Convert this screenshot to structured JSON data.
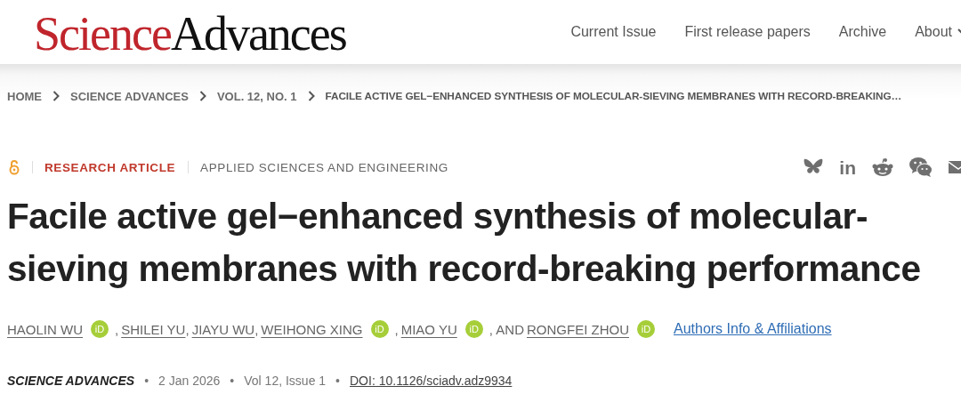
{
  "logo": {
    "first": "Science",
    "second": "Advances"
  },
  "nav": [
    {
      "label": "Current Issue",
      "dropdown": false
    },
    {
      "label": "First release papers",
      "dropdown": false
    },
    {
      "label": "Archive",
      "dropdown": false
    },
    {
      "label": "About",
      "dropdown": true
    }
  ],
  "breadcrumbs": [
    "HOME",
    "SCIENCE ADVANCES",
    "VOL. 12, NO. 1",
    "FACILE ACTIVE GEL−ENHANCED SYNTHESIS OF MOLECULAR-SIEVING MEMBRANES WITH RECORD-BREAKING…"
  ],
  "article": {
    "open_access": true,
    "type": "RESEARCH ARTICLE",
    "subject": "APPLIED SCIENCES AND ENGINEERING",
    "share": [
      {
        "kind": "butterfly"
      },
      {
        "kind": "linkedin",
        "text": "in"
      },
      {
        "kind": "reddit"
      },
      {
        "kind": "wechat"
      },
      {
        "kind": "mail"
      }
    ],
    "title": "Facile active gel−enhanced synthesis of molecular-sieving membranes with record-breaking performance",
    "authors": [
      {
        "name": "HAOLIN WU",
        "badge": "iD"
      },
      {
        "separator": ",",
        "name": "SHILEI YU"
      },
      {
        "separator": ",",
        "name": "JIAYU WU"
      },
      {
        "separator": ",",
        "name": "WEIHONG XING",
        "badge": "iD"
      },
      {
        "separator": ",",
        "name": "MIAO YU",
        "badge": "iD"
      },
      {
        "separator": ", AND",
        "name": "RONGFEI ZHOU",
        "badge": "iD"
      }
    ],
    "authors_link": "Authors Info & Affiliations",
    "meta": [
      {
        "kind": "journal",
        "text": "SCIENCE ADVANCES"
      },
      {
        "kind": "plain",
        "separator": "•",
        "text": "2 Jan 2026"
      },
      {
        "kind": "plain",
        "separator": "•",
        "text": "Vol 12, Issue 1"
      },
      {
        "kind": "link",
        "separator": "•",
        "text": "DOI: 10.1126/sciadv.adz9934"
      }
    ]
  }
}
